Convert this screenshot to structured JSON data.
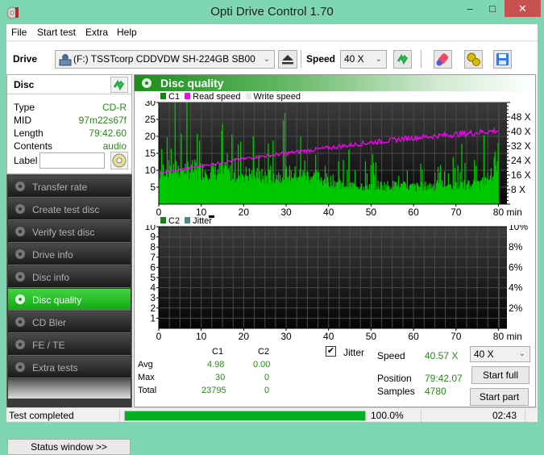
{
  "window": {
    "title": "Opti Drive Control 1.70",
    "controls": {
      "minimize": "–",
      "maximize": "□",
      "close": "✕"
    }
  },
  "menu": [
    "File",
    "Start test",
    "Extra",
    "Help"
  ],
  "toolbar": {
    "drive_label": "Drive",
    "drive_value": "(F:)  TSSTcorp CDDVDW SH-224GB SB00",
    "speed_label": "Speed",
    "speed_value": "40 X",
    "icons": [
      "eject-icon",
      "refresh-icon",
      "erase-icon",
      "settings-icon",
      "save-icon"
    ]
  },
  "disc": {
    "title": "Disc",
    "rows": [
      {
        "key": "Type",
        "value": "CD-R"
      },
      {
        "key": "MID",
        "value": "97m22s67f"
      },
      {
        "key": "Length",
        "value": "79:42.60"
      },
      {
        "key": "Contents",
        "value": "audio"
      }
    ],
    "label_key": "Label",
    "label_value": ""
  },
  "nav": [
    {
      "label": "Transfer rate",
      "active": false
    },
    {
      "label": "Create test disc",
      "active": false
    },
    {
      "label": "Verify test disc",
      "active": false
    },
    {
      "label": "Drive info",
      "active": false
    },
    {
      "label": "Disc info",
      "active": false
    },
    {
      "label": "Disc quality",
      "active": true
    },
    {
      "label": "CD Bler",
      "active": false
    },
    {
      "label": "FE / TE",
      "active": false
    },
    {
      "label": "Extra tests",
      "active": false
    }
  ],
  "status_window_button": "Status window >>",
  "panel": {
    "title": "Disc quality",
    "legend_top": [
      {
        "label": "C1",
        "color": "#0a8a0a"
      },
      {
        "label": "Read speed",
        "color": "#ff00ff"
      },
      {
        "label": "Write speed",
        "color": "#e8e8e8"
      }
    ],
    "legend_bottom": [
      {
        "label": "C2",
        "color": "#0a8a0a"
      },
      {
        "label": "Jitter",
        "color": "#4a8a8a"
      }
    ]
  },
  "chart_data": [
    {
      "type": "bar",
      "title": "C1 / Read speed",
      "x_label": "min",
      "x_range": [
        0,
        80
      ],
      "x_ticks": [
        0,
        10,
        20,
        30,
        40,
        50,
        60,
        70,
        80
      ],
      "y_range": [
        0,
        30
      ],
      "y_ticks": [
        5,
        10,
        15,
        20,
        25,
        30
      ],
      "y2_range": [
        0,
        56
      ],
      "y2_ticks": [
        "8 X",
        "16 X",
        "24 X",
        "32 X",
        "40 X",
        "48 X"
      ],
      "y2_values": [
        8,
        16,
        24,
        32,
        40,
        48
      ],
      "series": [
        {
          "name": "C1",
          "color": "#00c800",
          "avg": 4.98,
          "max": 30,
          "profile_x": [
            0,
            5,
            10,
            15,
            20,
            25,
            30,
            35,
            40,
            45,
            50,
            55,
            60,
            65,
            70,
            75,
            78,
            80
          ],
          "profile_y": [
            10,
            10.5,
            10,
            9.5,
            9,
            8,
            9,
            8.5,
            7,
            5.5,
            5.5,
            5.5,
            5,
            5.5,
            5.5,
            5.5,
            8,
            16
          ]
        },
        {
          "name": "Read speed",
          "color": "#ff00ff",
          "x": [
            0,
            10,
            20,
            30,
            40,
            50,
            60,
            70,
            80
          ],
          "y": [
            17,
            21,
            25,
            28,
            31,
            34,
            36.5,
            38.5,
            40.5
          ]
        }
      ],
      "grid": true
    },
    {
      "type": "bar",
      "title": "C2 / Jitter",
      "x_label": "min",
      "x_range": [
        0,
        80
      ],
      "x_ticks": [
        0,
        10,
        20,
        30,
        40,
        50,
        60,
        70,
        80
      ],
      "y_range": [
        0,
        10
      ],
      "y_ticks": [
        1,
        2,
        3,
        4,
        5,
        6,
        7,
        8,
        9,
        10
      ],
      "y2_ticks": [
        "2%",
        "4%",
        "6%",
        "8%",
        "10%"
      ],
      "y2_values": [
        2,
        4,
        6,
        8,
        10
      ],
      "series": [
        {
          "name": "C2",
          "color": "#0a8a0a",
          "values": []
        },
        {
          "name": "Jitter",
          "color": "#4a8a8a",
          "values": []
        }
      ],
      "grid": true
    }
  ],
  "stats": {
    "col_headers": [
      "C1",
      "C2"
    ],
    "rows": [
      {
        "label": "Avg",
        "c1": "4.98",
        "c2": "0.00"
      },
      {
        "label": "Max",
        "c1": "30",
        "c2": "0"
      },
      {
        "label": "Total",
        "c1": "23795",
        "c2": "0"
      }
    ],
    "jitter_label": "Jitter",
    "jitter_checked": true
  },
  "test_info": {
    "speed_label": "Speed",
    "speed_value": "40.57 X",
    "position_label": "Position",
    "position_value": "79:42.07",
    "samples_label": "Samples",
    "samples_value": "4780",
    "speed_select": "40 X",
    "start_full": "Start full",
    "start_part": "Start part"
  },
  "statusbar": {
    "status": "Test completed",
    "progress_percent": 100,
    "progress_text": "100.0%",
    "elapsed": "02:43"
  }
}
